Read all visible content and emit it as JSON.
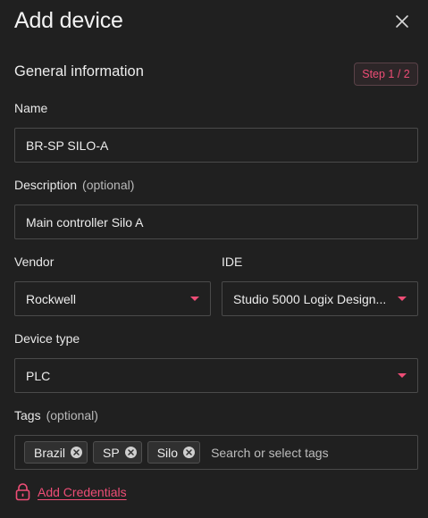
{
  "header": {
    "title": "Add device"
  },
  "section": {
    "title": "General information",
    "step": "Step 1 / 2"
  },
  "form": {
    "name": {
      "label": "Name",
      "value": "BR-SP SILO-A"
    },
    "description": {
      "label": "Description",
      "optional": "(optional)",
      "value": "Main controller Silo A"
    },
    "vendor": {
      "label": "Vendor",
      "value": "Rockwell"
    },
    "ide": {
      "label": "IDE",
      "value": "Studio 5000 Logix Design..."
    },
    "device_type": {
      "label": "Device type",
      "value": "PLC"
    },
    "tags": {
      "label": "Tags",
      "optional": "(optional)",
      "items": [
        "Brazil",
        "SP",
        "Silo"
      ],
      "placeholder": "Search or select tags"
    }
  },
  "credentials": {
    "link_label": "Add Credentials"
  },
  "colors": {
    "accent": "#ee4d76",
    "background": "#202020",
    "border": "#4a4a4a"
  },
  "icons": {
    "close": "close-icon",
    "caret": "caret-down-icon",
    "chip_remove": "remove-circle-icon",
    "lock": "lock-icon"
  }
}
